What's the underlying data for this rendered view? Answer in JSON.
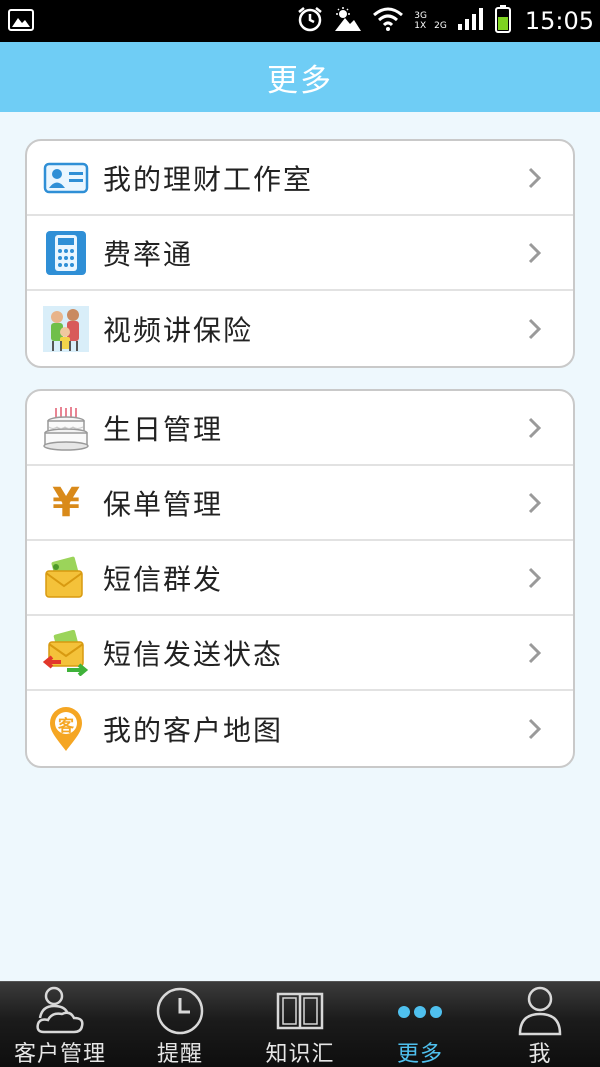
{
  "status_bar": {
    "time": "15:05",
    "network_top": "3G",
    "network_bottom": "1X",
    "network_right": "2G"
  },
  "header": {
    "title": "更多"
  },
  "groups": [
    {
      "items": [
        {
          "label": "我的理财工作室",
          "icon": "id-card-icon"
        },
        {
          "label": "费率通",
          "icon": "calculator-icon"
        },
        {
          "label": "视频讲保险",
          "icon": "family-video-icon"
        }
      ]
    },
    {
      "items": [
        {
          "label": "生日管理",
          "icon": "birthday-cake-icon"
        },
        {
          "label": "保单管理",
          "icon": "yuan-icon"
        },
        {
          "label": "短信群发",
          "icon": "mail-icon"
        },
        {
          "label": "短信发送状态",
          "icon": "mail-arrows-icon"
        },
        {
          "label": "我的客户地图",
          "icon": "map-pin-icon"
        }
      ]
    }
  ],
  "map_pin_char": "客",
  "yuan_char": "¥",
  "tabbar": {
    "active_index": 3,
    "active_color": "#4fc0ee",
    "tabs": [
      {
        "label": "客户管理",
        "icon": "customers-icon"
      },
      {
        "label": "提醒",
        "icon": "clock-icon"
      },
      {
        "label": "知识汇",
        "icon": "book-icon"
      },
      {
        "label": "更多",
        "icon": "more-dots-icon"
      },
      {
        "label": "我",
        "icon": "user-icon"
      }
    ]
  },
  "colors": {
    "header_bg": "#6fcdf5",
    "page_bg": "#eef8fd"
  }
}
